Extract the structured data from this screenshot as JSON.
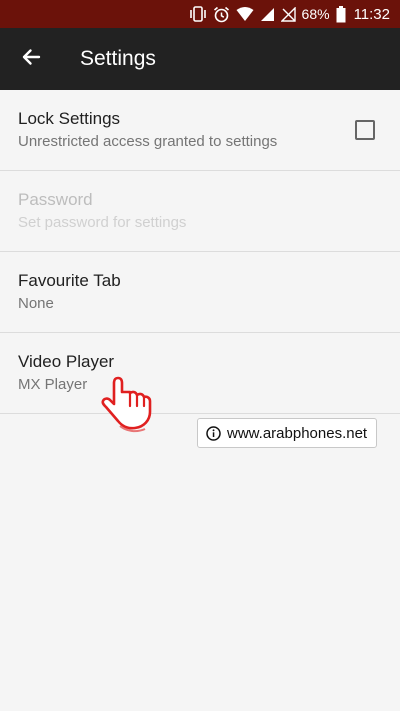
{
  "status_bar": {
    "battery_percent": "68%",
    "time": "11:32",
    "icons": [
      "vibrate-icon",
      "alarm-icon",
      "wifi-icon",
      "signal-icon",
      "no-sim-icon",
      "battery-icon"
    ]
  },
  "app_bar": {
    "title": "Settings",
    "back_icon": "arrow-left-icon"
  },
  "settings": [
    {
      "title": "Lock Settings",
      "subtitle": "Unrestricted access granted to settings",
      "enabled": true,
      "checkbox": false
    },
    {
      "title": "Password",
      "subtitle": "Set password for settings",
      "enabled": false
    },
    {
      "title": "Favourite Tab",
      "subtitle": "None",
      "enabled": true
    },
    {
      "title": "Video Player",
      "subtitle": "MX Player",
      "enabled": true
    }
  ],
  "watermark": {
    "text": "www.arabphones.net",
    "icon": "info-icon"
  },
  "colors": {
    "status_bar": "#6b120a",
    "app_bar": "#222222",
    "background": "#f5f5f5",
    "hand": "#e02020"
  }
}
